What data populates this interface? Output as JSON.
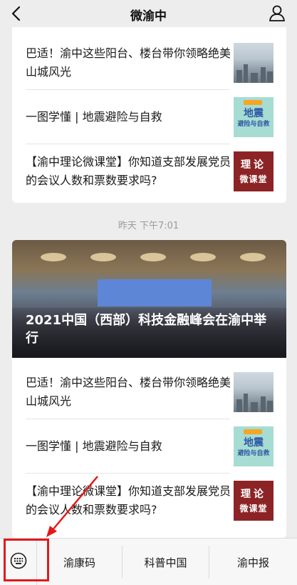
{
  "header": {
    "title": "微渝中",
    "back_icon": "chevron-left-icon",
    "profile_icon": "person-icon"
  },
  "top_card": {
    "items": [
      {
        "title": "巴适！渝中这些阳台、楼台带你领略绝美山城风光",
        "thumb": "city-view"
      },
      {
        "title": "一图学懂 | 地震避险与自救",
        "thumb": "earthquake-guide"
      },
      {
        "title": "【渝中理论微课堂】你知道支部发展党员的会议人数和票数要求吗?",
        "thumb": "theory-class"
      }
    ]
  },
  "timestamp": "昨天 下午7:01",
  "bottom_card": {
    "hero": {
      "caption": "2021中国（西部）科技金融峰会在渝中举行"
    },
    "items": [
      {
        "title": "巴适！渝中这些阳台、楼台带你领略绝美山城风光",
        "thumb": "city-view"
      },
      {
        "title": "一图学懂 | 地震避险与自救",
        "thumb": "earthquake-guide"
      },
      {
        "title": "【渝中理论微课堂】你知道支部发展党员的会议人数和票数要求吗?",
        "thumb": "theory-class"
      }
    ]
  },
  "thumbnails": {
    "earthquake_title": "地震",
    "earthquake_subtitle": "避险与自救",
    "theory_line1": "理论",
    "theory_line2": "微课堂"
  },
  "bottom_bar": {
    "keyboard_icon": "keyboard-icon",
    "menus": [
      "渝康码",
      "科普中国",
      "渝中报"
    ]
  },
  "colors": {
    "background": "#ededed",
    "annotation_red": "#e3191b",
    "theory_thumb": "#8c2426",
    "quake_thumb": "#a7dcd3"
  }
}
